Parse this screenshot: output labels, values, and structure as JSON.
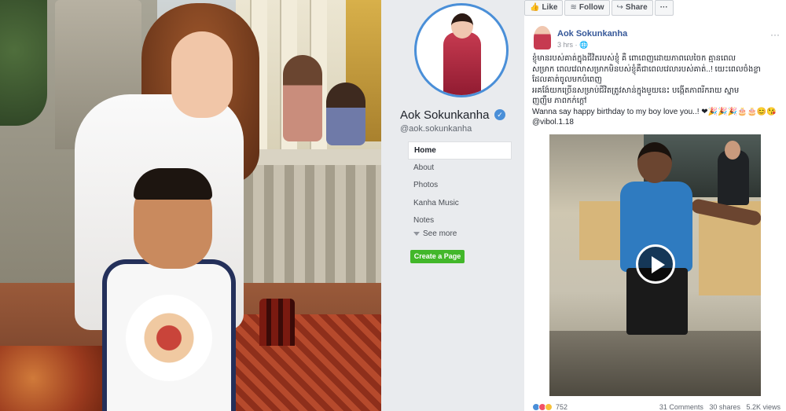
{
  "profile": {
    "name": "Aok Sokunkanha",
    "handle": "@aok.sokunkanha",
    "verified_icon": "verified-badge-icon"
  },
  "nav": {
    "items": [
      "Home",
      "About",
      "Photos",
      "Kanha Music",
      "Notes"
    ],
    "active": "Home",
    "see_more": "See more",
    "create_page": "Create a Page"
  },
  "actions": {
    "like": "Like",
    "follow": "Follow",
    "share": "Share",
    "more": "···"
  },
  "post": {
    "author": "Aok Sokunkanha",
    "time": "3 hrs · ",
    "privacy_icon": "globe-icon",
    "text_lines": [
      "ខ្ញុំមានរបស់គាត់ក្នុងជីវិតរបស់ខ្ញុំ គឺ ពោពេញដោយភាពលេចៃក គ្មានពេល",
      "សម្រាក ពេលវេលាសម្រាកមិនបស់ខ្ញុំគឺជាពេលវេលារបស់គាត់..! យេះពេលចំងខ្លា",
      "ដែលគាត់ចូលមកបំពេញ",
      "អគង៉ែយកច្រើនសម្រាប់ជីវិតត្រូវសាន់ក្នុងមួយនេះ បង្កើតភាពរីករាយ ស្នាម",
      "ញញឹម ភាពកក់ក្តៅ",
      "Wanna say happy birthday to my boy love you..! ❤🎉🎉🎉🎂🎂😊😘",
      "@vibol.1.18"
    ],
    "reactions_count": "752",
    "comments": "31 Comments",
    "shares": "30 shares",
    "views": "5.2K views"
  },
  "colors": {
    "fb_blue": "#365899",
    "accent_blue": "#4a8fd8",
    "create_green": "#42b72a",
    "bg": "#e9ebee"
  }
}
